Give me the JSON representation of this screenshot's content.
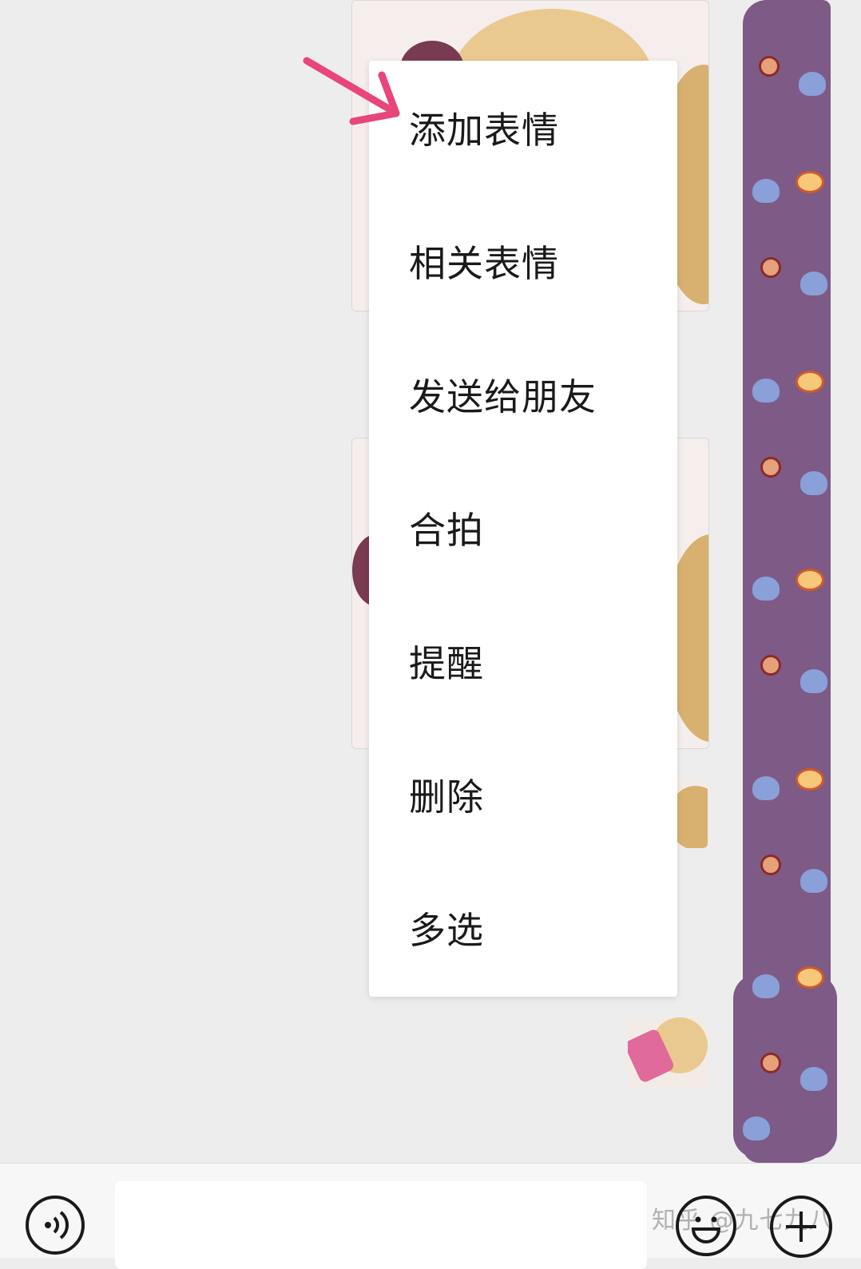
{
  "context_menu": {
    "items": [
      {
        "label": "添加表情"
      },
      {
        "label": "相关表情"
      },
      {
        "label": "发送给朋友"
      },
      {
        "label": "合拍"
      },
      {
        "label": "提醒"
      },
      {
        "label": "删除"
      },
      {
        "label": "多选"
      }
    ]
  },
  "annotation": {
    "color": "#e8457a"
  },
  "watermark": {
    "text": "知乎 @九七九八"
  },
  "bottom_bar": {
    "voice_icon": "voice-icon",
    "emoji_icon": "emoji-icon",
    "plus_icon": "plus-icon"
  },
  "colors": {
    "background": "#ededed",
    "menu": "#ffffff",
    "avatar_strip": "#7e5a86"
  }
}
